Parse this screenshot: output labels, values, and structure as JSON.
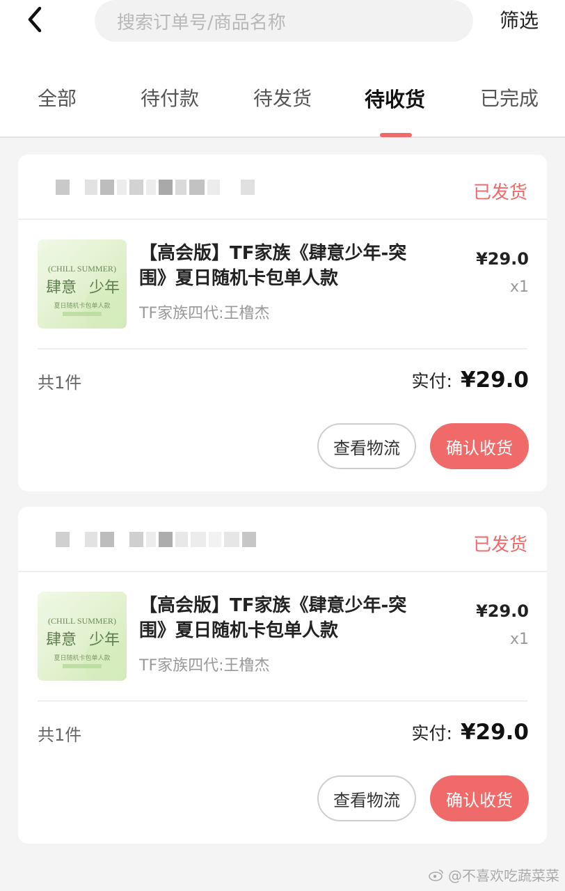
{
  "header": {
    "search_placeholder": "搜索订单号/商品名称",
    "filter_label": "筛选"
  },
  "tabs": [
    {
      "label": "全部",
      "active": false
    },
    {
      "label": "待付款",
      "active": false
    },
    {
      "label": "待发货",
      "active": false
    },
    {
      "label": "待收货",
      "active": true
    },
    {
      "label": "已完成",
      "active": false
    }
  ],
  "orders": [
    {
      "status": "已发货",
      "item": {
        "title": "【高会版】TF家族《肆意少年-突围》夏日随机卡包单人款",
        "variant": "TF家族四代:王橹杰",
        "price": "¥29.0",
        "qty": "x1",
        "thumb_text_en": "(CHILL SUMMER)",
        "thumb_text_cn_left": "肆意",
        "thumb_text_cn_right": "少年",
        "thumb_text_sub": "夏日随机卡包单人款"
      },
      "count": "共1件",
      "paid_label": "实付:",
      "paid_amount": "¥29.0",
      "btn_logistics": "查看物流",
      "btn_confirm": "确认收货"
    },
    {
      "status": "已发货",
      "item": {
        "title": "【高会版】TF家族《肆意少年-突围》夏日随机卡包单人款",
        "variant": "TF家族四代:王橹杰",
        "price": "¥29.0",
        "qty": "x1",
        "thumb_text_en": "(CHILL SUMMER)",
        "thumb_text_cn_left": "肆意",
        "thumb_text_cn_right": "少年",
        "thumb_text_sub": "夏日随机卡包单人款"
      },
      "count": "共1件",
      "paid_label": "实付:",
      "paid_amount": "¥29.0",
      "btn_logistics": "查看物流",
      "btn_confirm": "确认收货"
    }
  ],
  "watermark": "@不喜欢吃蔬菜菜",
  "colors": {
    "accent": "#f06a6a",
    "background": "#f4f4f4"
  }
}
